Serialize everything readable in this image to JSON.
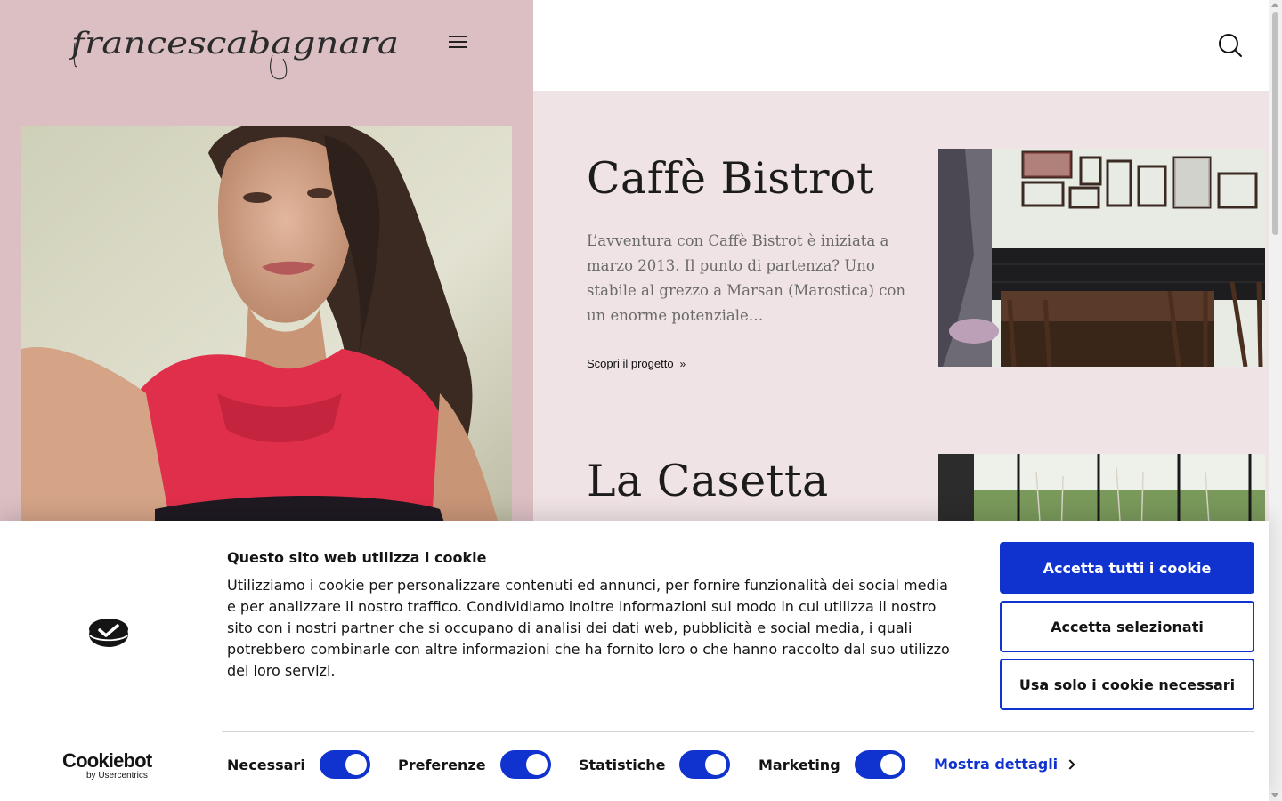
{
  "header": {
    "logo_text": "francescabagnara",
    "menu_icon": "hamburger-menu-icon",
    "search_icon": "search-icon"
  },
  "projects": [
    {
      "title": "Caffè Bistrot",
      "excerpt": "L’avventura con Caffè Bistrot è iniziata a marzo 2013. Il punto di partenza? Uno stabile al grezzo a Marsan (Marostica) con un enorme potenziale…",
      "link_label": "Scopri il progetto"
    },
    {
      "title": "La Casetta"
    }
  ],
  "cookie_banner": {
    "title": "Questo sito web utilizza i cookie",
    "text": "Utilizziamo i cookie per personalizzare contenuti ed annunci, per fornire funzionalità dei social media e per analizzare il nostro traffico. Condividiamo inoltre informazioni sul modo in cui utilizza il nostro sito con i nostri partner che si occupano di analisi dei dati web, pubblicità e social media, i quali potrebbero combinarle con altre informazioni che ha fornito loro o che hanno raccolto dal suo utilizzo dei loro servizi.",
    "buttons": {
      "accept_all": "Accetta tutti i cookie",
      "accept_selected": "Accetta selezionati",
      "necessary_only": "Usa solo i cookie necessari"
    },
    "categories": [
      {
        "label": "Necessari",
        "enabled": true
      },
      {
        "label": "Preferenze",
        "enabled": true
      },
      {
        "label": "Statistiche",
        "enabled": true
      },
      {
        "label": "Marketing",
        "enabled": true
      }
    ],
    "details_link": "Mostra dettagli",
    "brand": {
      "name": "Cookiebot",
      "by": "by Usercentrics"
    },
    "accent_color": "#1032cf"
  },
  "colors": {
    "sidebar_bg": "#dbbfc3",
    "content_bg": "#f0e3e5"
  }
}
